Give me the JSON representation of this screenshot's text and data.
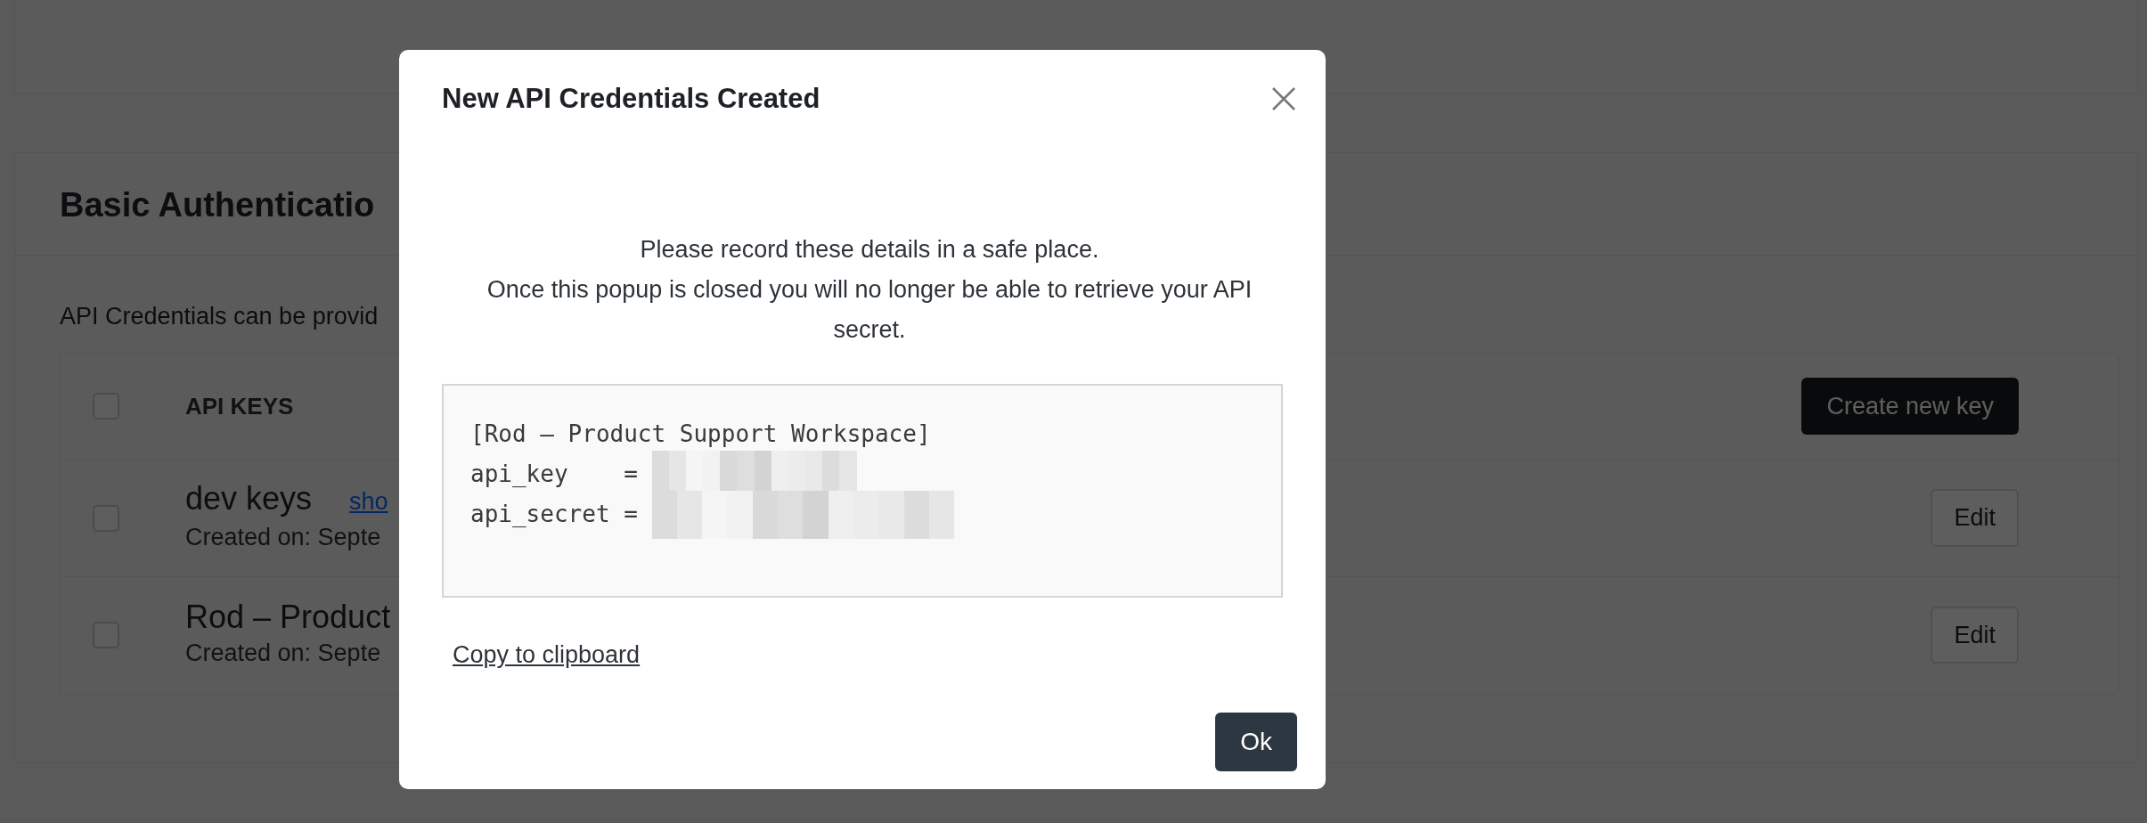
{
  "page": {
    "card_title": "Basic Authenticatio",
    "description": "API Credentials can be provid",
    "table": {
      "header": {
        "checked": false,
        "label": "API KEYS",
        "action": "Create new key"
      },
      "rows": [
        {
          "checked": false,
          "name": "dev keys",
          "link": "sho",
          "created": "Created on: Septe",
          "action": "Edit"
        },
        {
          "checked": false,
          "name": "Rod – Product",
          "link": "",
          "created": "Created on: Septe",
          "action": "Edit"
        }
      ]
    }
  },
  "modal": {
    "title": "New API Credentials Created",
    "message": [
      "Please record these details in a safe place.",
      "Once this popup is closed you will no longer be able to retrieve your API secret."
    ],
    "code_lines": [
      {
        "kind": "section",
        "text": "[Rod – Product Support Workspace]"
      },
      {
        "kind": "masked",
        "text": "api_key    = "
      },
      {
        "kind": "masked",
        "text": "api_secret = "
      }
    ],
    "copy_link": "Copy to clipboard",
    "ok_button": "Ok"
  }
}
